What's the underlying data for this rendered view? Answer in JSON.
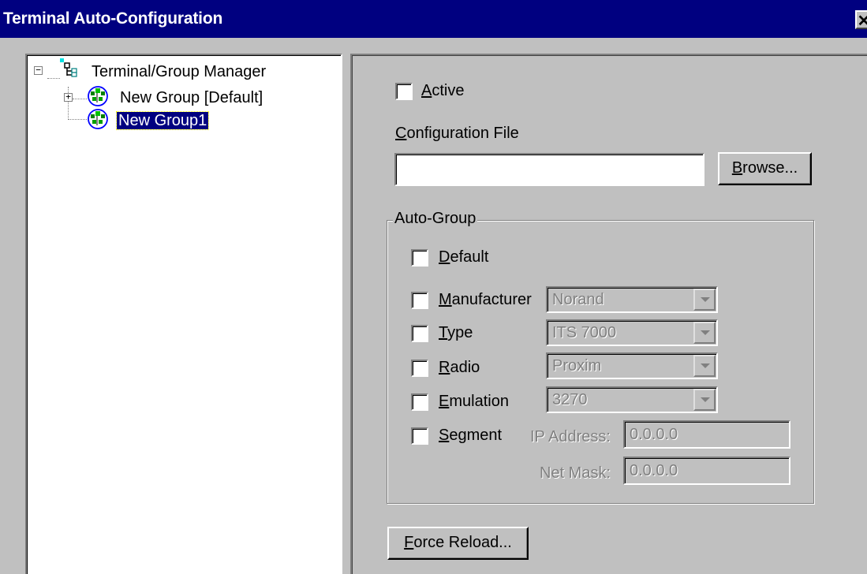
{
  "window": {
    "title": "Terminal Auto-Configuration",
    "close_glyph": "✕"
  },
  "tree": {
    "root": {
      "label": "Terminal/Group Manager",
      "icon": "tree-root-icon",
      "expander": "−"
    },
    "items": [
      {
        "label": "New Group [Default]",
        "icon": "group-icon",
        "expander": "+",
        "selected": false
      },
      {
        "label": "New Group1",
        "icon": "group-icon",
        "selected": true
      }
    ]
  },
  "settings": {
    "active_label": "Active",
    "active_checked": false,
    "config_file_label": "Configuration File",
    "config_file_value": "",
    "browse_button": "Browse...",
    "force_reload_button": "Force Reload..."
  },
  "auto_group": {
    "title": "Auto-Group",
    "default_label": "Default",
    "manufacturer_label": "Manufacturer",
    "manufacturer_value": "Norand",
    "type_label": "Type",
    "type_value": "ITS 7000",
    "radio_label": "Radio",
    "radio_value": "Proxim",
    "emulation_label": "Emulation",
    "emulation_value": "3270",
    "segment_label": "Segment",
    "ip_address_label": "IP Address:",
    "ip_address_value": "0.0.0.0",
    "net_mask_label": "Net Mask:",
    "net_mask_value": "0.0.0.0"
  },
  "colors": {
    "title_bar": "#000080",
    "face": "#c0c0c0",
    "selection": "#000080",
    "group_icon_green": "#008000",
    "group_icon_blue": "#0000ff"
  }
}
